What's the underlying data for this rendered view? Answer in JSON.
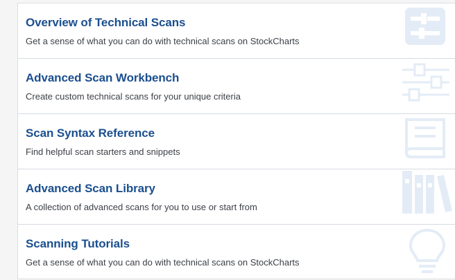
{
  "items": [
    {
      "title": "Overview of Technical Scans",
      "description": "Get a sense of what you can do with technical scans on StockCharts",
      "icon": "settings-panel-icon"
    },
    {
      "title": "Advanced Scan Workbench",
      "description": "Create custom technical scans for your unique criteria",
      "icon": "sliders-icon"
    },
    {
      "title": "Scan Syntax Reference",
      "description": "Find helpful scan starters and snippets",
      "icon": "book-icon"
    },
    {
      "title": "Advanced Scan Library",
      "description": "A collection of advanced scans for you to use or start from",
      "icon": "library-icon"
    },
    {
      "title": "Scanning Tutorials",
      "description": "Get a sense of what you can do with technical scans on StockCharts",
      "icon": "lightbulb-icon"
    }
  ],
  "colors": {
    "title": "#1b4f8f",
    "description": "#3b3f45",
    "icon": "#e3ecf6",
    "divider": "#d5dae0"
  }
}
